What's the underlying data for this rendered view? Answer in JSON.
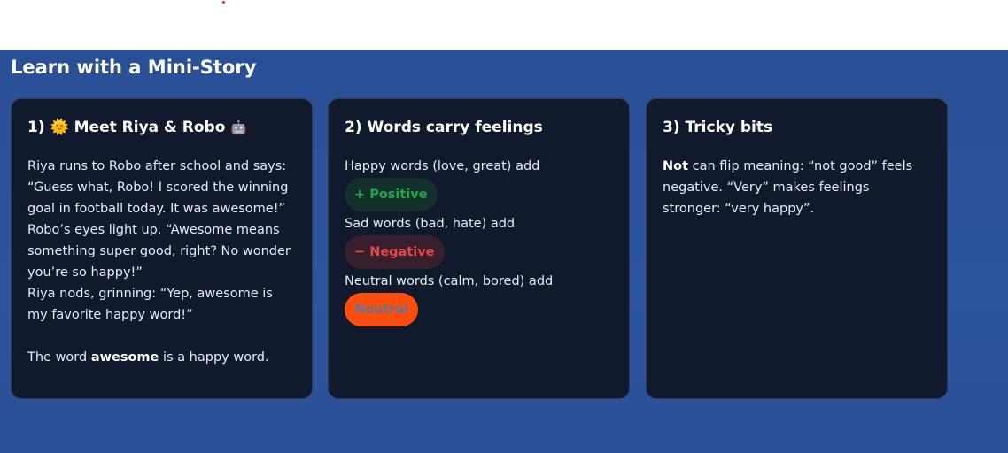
{
  "header": {
    "section_title": "Learn with a Mini-Story"
  },
  "cards": [
    {
      "title_prefix": "1)",
      "title_icon_start": "🌞",
      "title_text": "Meet Riya & Robo",
      "title_icon_end": "🤖",
      "story_lines": [
        "Riya runs to Robo after school and says: “Guess what, Robo! I scored the winning goal in football today. It was awesome!”",
        "Robo’s eyes light up. “Awesome means something super good, right? No wonder you’re so happy!”",
        "Riya nods, grinning: “Yep, awesome is my favorite happy word!”"
      ],
      "summary_before": "The word ",
      "summary_bold": "awesome",
      "summary_after": " is a happy word."
    },
    {
      "title": "2) Words carry feelings",
      "rows": [
        {
          "text": "Happy words (love, great) add",
          "chip": "+ Positive"
        },
        {
          "text": "Sad words (bad, hate) add",
          "chip": "− Negative"
        },
        {
          "text": "Neutral words (calm, bored) add",
          "chip": "Neutral"
        }
      ]
    },
    {
      "title": "3) Tricky bits",
      "bold_word": "Not",
      "text": " can flip meaning: “not good” feels negative. “Very” makes feelings stronger: “very happy”."
    }
  ],
  "colors": {
    "section_bg": "#2d559e",
    "card_bg": "#111a2d",
    "positive": "#1fa64a",
    "negative": "#e8464a",
    "neutral_bg": "#ff4d0e"
  }
}
